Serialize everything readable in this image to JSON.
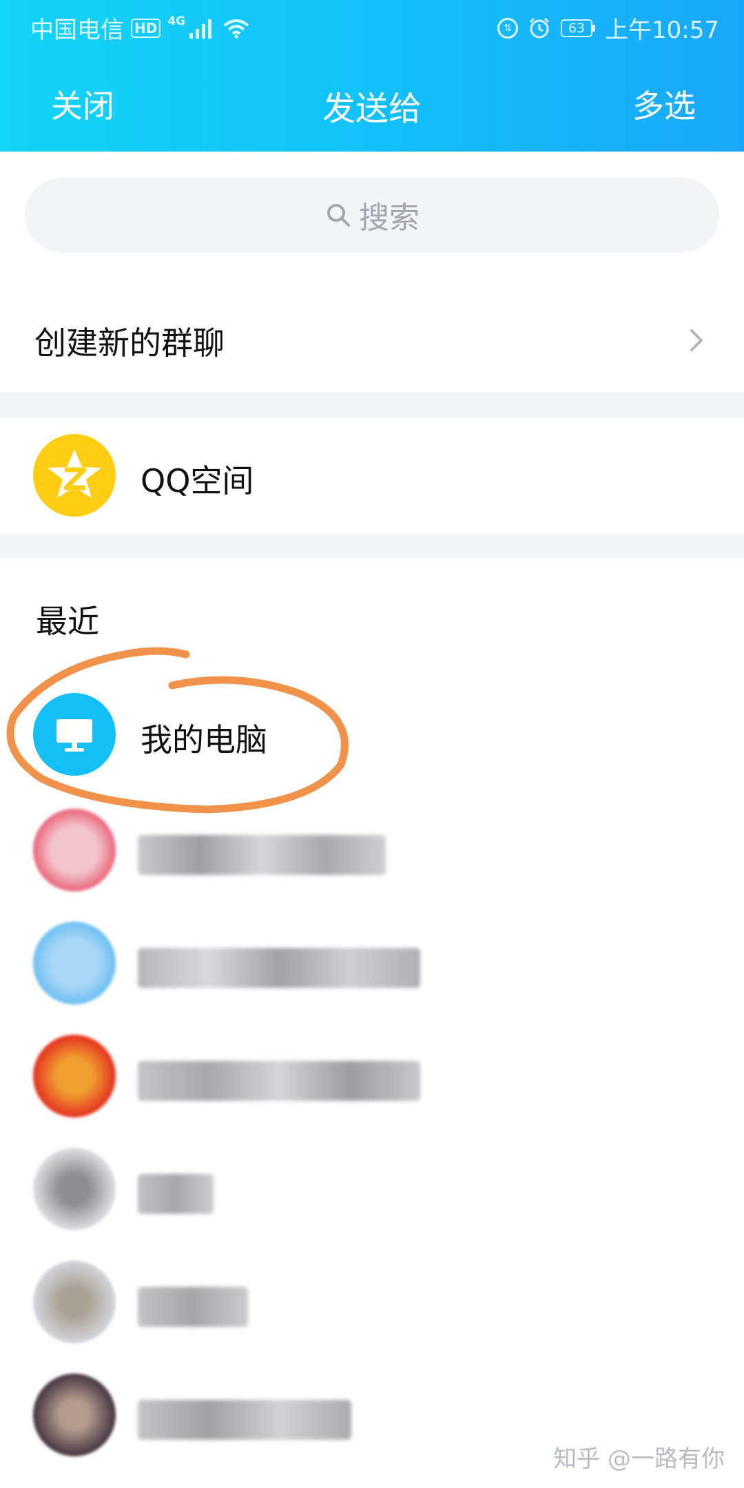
{
  "status_bar": {
    "carrier": "中国电信",
    "hd": "HD",
    "network": "4G",
    "battery": "63",
    "time": "上午10:57"
  },
  "nav": {
    "close_label": "关闭",
    "title": "发送给",
    "multi_select_label": "多选"
  },
  "search": {
    "placeholder": "搜索"
  },
  "create_group": {
    "label": "创建新的群聊"
  },
  "qzone": {
    "label": "QQ空间"
  },
  "recent": {
    "heading": "最近",
    "contacts": [
      {
        "name": "我的电脑",
        "highlighted": true
      },
      {
        "name": ""
      },
      {
        "name": ""
      },
      {
        "name": ""
      },
      {
        "name": ""
      },
      {
        "name": ""
      },
      {
        "name": ""
      }
    ]
  },
  "watermark": "知乎 @一路有你",
  "colors": {
    "header_start": "#14d4f7",
    "header_end": "#1aa7f9",
    "highlight_stroke": "#f0924a",
    "qzone_yellow": "#ffcd14",
    "pc_blue": "#14bff5"
  }
}
